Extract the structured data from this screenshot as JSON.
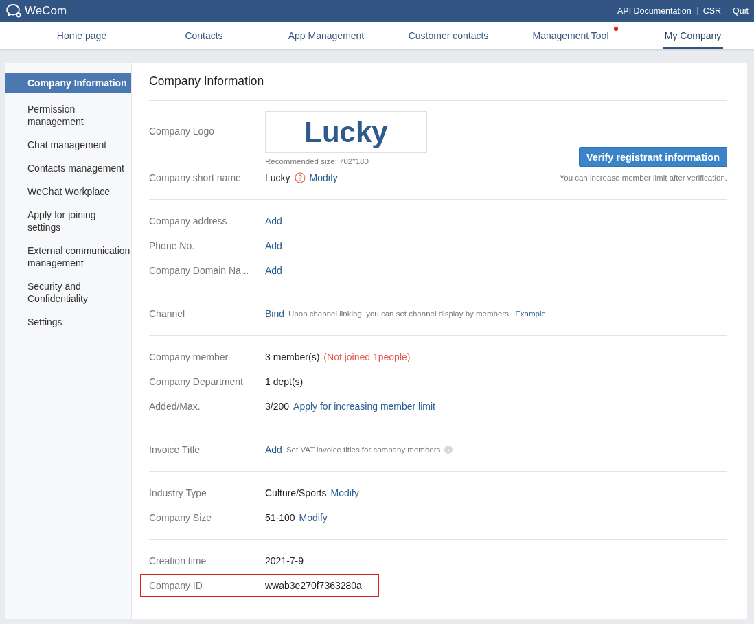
{
  "header": {
    "brand": "WeCom",
    "links": [
      "API Documentation",
      "CSR",
      "Quit"
    ]
  },
  "nav": [
    {
      "label": "Home page",
      "selected": false,
      "badge": false
    },
    {
      "label": "Contacts",
      "selected": false,
      "badge": false
    },
    {
      "label": "App Management",
      "selected": false,
      "badge": false
    },
    {
      "label": "Customer contacts",
      "selected": false,
      "badge": false
    },
    {
      "label": "Management Tool",
      "selected": false,
      "badge": true
    },
    {
      "label": "My Company",
      "selected": true,
      "badge": false
    }
  ],
  "sidebar": {
    "items": [
      {
        "label": "Company Information",
        "selected": true
      },
      {
        "label": "Permission management",
        "selected": false
      },
      {
        "label": "Chat management",
        "selected": false
      },
      {
        "label": "Contacts management",
        "selected": false
      },
      {
        "label": "WeChat Workplace",
        "selected": false
      },
      {
        "label": "Apply for joining settings",
        "selected": false
      },
      {
        "label": "External communication management",
        "selected": false
      },
      {
        "label": "Security and Confidentiality",
        "selected": false
      },
      {
        "label": "Settings",
        "selected": false
      }
    ]
  },
  "page_title": "Company Information",
  "logo": {
    "label": "Company Logo",
    "text": "Lucky",
    "hint": "Recommended size: 702*180"
  },
  "verify": {
    "button": "Verify registrant information",
    "note": "You can increase member limit after verification."
  },
  "sections": [
    {
      "rows": [
        {
          "label": "Company short name",
          "highlighted": false,
          "parts": [
            {
              "kind": "text",
              "text": "Lucky"
            },
            {
              "kind": "help"
            },
            {
              "kind": "link",
              "text": "Modify"
            }
          ]
        }
      ]
    },
    {
      "rows": [
        {
          "label": "Company address",
          "highlighted": false,
          "parts": [
            {
              "kind": "link",
              "text": "Add"
            }
          ]
        },
        {
          "label": "Phone No.",
          "highlighted": false,
          "parts": [
            {
              "kind": "link",
              "text": "Add"
            }
          ]
        },
        {
          "label": "Company Domain Na...",
          "highlighted": false,
          "parts": [
            {
              "kind": "link",
              "text": "Add"
            }
          ]
        }
      ]
    },
    {
      "rows": [
        {
          "label": "Channel",
          "highlighted": false,
          "parts": [
            {
              "kind": "link",
              "text": "Bind"
            },
            {
              "kind": "hint",
              "text": "Upon channel linking, you can set channel display by members."
            },
            {
              "kind": "small_link",
              "text": "Example"
            }
          ]
        }
      ]
    },
    {
      "rows": [
        {
          "label": "Company member",
          "highlighted": false,
          "parts": [
            {
              "kind": "text",
              "text": "3 member(s)"
            },
            {
              "kind": "alert",
              "text": "(Not joined 1people)"
            }
          ]
        },
        {
          "label": "Company Department",
          "highlighted": false,
          "parts": [
            {
              "kind": "text",
              "text": "1 dept(s)"
            }
          ]
        },
        {
          "label": "Added/Max.",
          "highlighted": false,
          "parts": [
            {
              "kind": "text",
              "text": "3/200"
            },
            {
              "kind": "link",
              "text": "Apply for increasing member limit"
            }
          ]
        }
      ]
    },
    {
      "rows": [
        {
          "label": "Invoice Title",
          "highlighted": false,
          "parts": [
            {
              "kind": "link",
              "text": "Add"
            },
            {
              "kind": "hint",
              "text": "Set VAT invoice titles for company members"
            },
            {
              "kind": "info"
            }
          ]
        }
      ]
    },
    {
      "rows": [
        {
          "label": "Industry Type",
          "highlighted": false,
          "parts": [
            {
              "kind": "text",
              "text": "Culture/Sports"
            },
            {
              "kind": "link",
              "text": "Modify"
            }
          ]
        },
        {
          "label": "Company Size",
          "highlighted": false,
          "parts": [
            {
              "kind": "text",
              "text": "51-100"
            },
            {
              "kind": "link",
              "text": "Modify"
            }
          ]
        }
      ]
    },
    {
      "rows": [
        {
          "label": "Creation time",
          "highlighted": false,
          "parts": [
            {
              "kind": "text",
              "text": "2021-7-9"
            }
          ]
        },
        {
          "label": "Company ID",
          "highlighted": true,
          "parts": [
            {
              "kind": "text",
              "text": "wwab3e270f7363280a"
            }
          ]
        }
      ]
    }
  ]
}
